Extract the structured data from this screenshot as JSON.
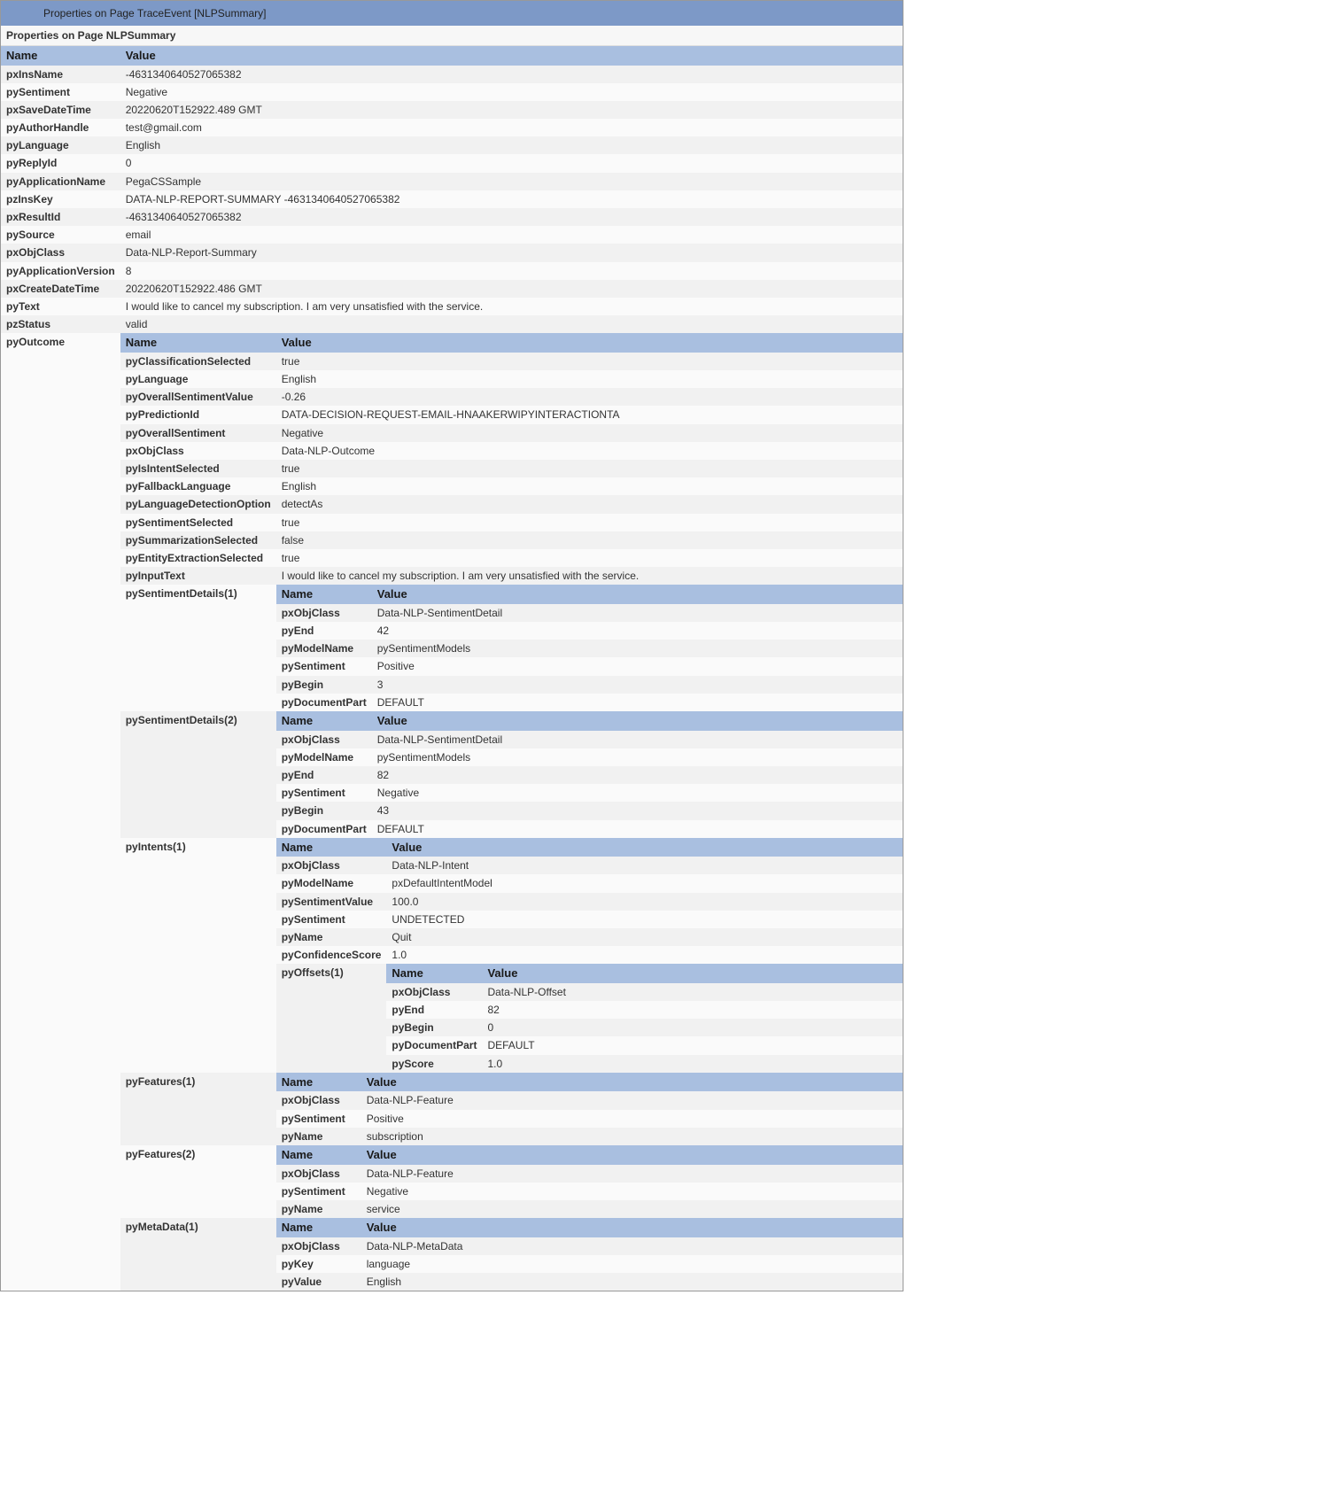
{
  "banner": {
    "title": "Properties on Page TraceEvent [NLPSummary]"
  },
  "section_title": "Properties on Page NLPSummary",
  "columns": {
    "name": "Name",
    "value": "Value"
  },
  "level0": [
    {
      "k": "pxInsName",
      "v": "-4631340640527065382"
    },
    {
      "k": "pySentiment",
      "v": "Negative"
    },
    {
      "k": "pxSaveDateTime",
      "v": "20220620T152922.489 GMT"
    },
    {
      "k": "pyAuthorHandle",
      "v": "test@gmail.com"
    },
    {
      "k": "pyLanguage",
      "v": "English"
    },
    {
      "k": "pyReplyId",
      "v": "0"
    },
    {
      "k": "pyApplicationName",
      "v": "PegaCSSample"
    },
    {
      "k": "pzInsKey",
      "v": "DATA-NLP-REPORT-SUMMARY -4631340640527065382"
    },
    {
      "k": "pxResultId",
      "v": "-4631340640527065382"
    },
    {
      "k": "pySource",
      "v": "email"
    },
    {
      "k": "pxObjClass",
      "v": "Data-NLP-Report-Summary"
    },
    {
      "k": "pyApplicationVersion",
      "v": "8"
    },
    {
      "k": "pxCreateDateTime",
      "v": "20220620T152922.486 GMT"
    },
    {
      "k": "pyText",
      "v": "I would like to cancel my subscription. I am very unsatisfied with the service."
    },
    {
      "k": "pzStatus",
      "v": "valid"
    }
  ],
  "outcome_key": "pyOutcome",
  "outcome_simple": [
    {
      "k": "pyClassificationSelected",
      "v": "true"
    },
    {
      "k": "pyLanguage",
      "v": "English"
    },
    {
      "k": "pyOverallSentimentValue",
      "v": "-0.26"
    },
    {
      "k": "pyPredictionId",
      "v": "DATA-DECISION-REQUEST-EMAIL-HNAAKERWIPYINTERACTIONTA"
    },
    {
      "k": "pyOverallSentiment",
      "v": "Negative"
    },
    {
      "k": "pxObjClass",
      "v": "Data-NLP-Outcome"
    },
    {
      "k": "pyIsIntentSelected",
      "v": "true"
    },
    {
      "k": "pyFallbackLanguage",
      "v": "English"
    },
    {
      "k": "pyLanguageDetectionOption",
      "v": "detectAs"
    },
    {
      "k": "pySentimentSelected",
      "v": "true"
    },
    {
      "k": "pySummarizationSelected",
      "v": "false"
    },
    {
      "k": "pyEntityExtractionSelected",
      "v": "true"
    },
    {
      "k": "pyInputText",
      "v": "I would like to cancel my subscription. I am very unsatisfied with the service."
    }
  ],
  "sentiment1_key": "pySentimentDetails(1)",
  "sentiment1": [
    {
      "k": "pxObjClass",
      "v": "Data-NLP-SentimentDetail"
    },
    {
      "k": "pyEnd",
      "v": "42"
    },
    {
      "k": "pyModelName",
      "v": "pySentimentModels"
    },
    {
      "k": "pySentiment",
      "v": "Positive"
    },
    {
      "k": "pyBegin",
      "v": "3"
    },
    {
      "k": "pyDocumentPart",
      "v": "DEFAULT"
    }
  ],
  "sentiment2_key": "pySentimentDetails(2)",
  "sentiment2": [
    {
      "k": "pxObjClass",
      "v": "Data-NLP-SentimentDetail"
    },
    {
      "k": "pyModelName",
      "v": "pySentimentModels"
    },
    {
      "k": "pyEnd",
      "v": "82"
    },
    {
      "k": "pySentiment",
      "v": "Negative"
    },
    {
      "k": "pyBegin",
      "v": "43"
    },
    {
      "k": "pyDocumentPart",
      "v": "DEFAULT"
    }
  ],
  "intents1_key": "pyIntents(1)",
  "intents1_simple": [
    {
      "k": "pxObjClass",
      "v": "Data-NLP-Intent"
    },
    {
      "k": "pyModelName",
      "v": "pxDefaultIntentModel"
    },
    {
      "k": "pySentimentValue",
      "v": "100.0"
    },
    {
      "k": "pySentiment",
      "v": "UNDETECTED"
    },
    {
      "k": "pyName",
      "v": "Quit"
    },
    {
      "k": "pyConfidenceScore",
      "v": "1.0"
    }
  ],
  "offsets1_key": "pyOffsets(1)",
  "offsets1": [
    {
      "k": "pxObjClass",
      "v": "Data-NLP-Offset"
    },
    {
      "k": "pyEnd",
      "v": "82"
    },
    {
      "k": "pyBegin",
      "v": "0"
    },
    {
      "k": "pyDocumentPart",
      "v": "DEFAULT"
    },
    {
      "k": "pyScore",
      "v": "1.0"
    }
  ],
  "features1_key": "pyFeatures(1)",
  "features1": [
    {
      "k": "pxObjClass",
      "v": "Data-NLP-Feature"
    },
    {
      "k": "pySentiment",
      "v": "Positive"
    },
    {
      "k": "pyName",
      "v": "subscription"
    }
  ],
  "features2_key": "pyFeatures(2)",
  "features2": [
    {
      "k": "pxObjClass",
      "v": "Data-NLP-Feature"
    },
    {
      "k": "pySentiment",
      "v": "Negative"
    },
    {
      "k": "pyName",
      "v": "service"
    }
  ],
  "metadata1_key": "pyMetaData(1)",
  "metadata1": [
    {
      "k": "pxObjClass",
      "v": "Data-NLP-MetaData"
    },
    {
      "k": "pyKey",
      "v": "language"
    },
    {
      "k": "pyValue",
      "v": "English"
    }
  ]
}
